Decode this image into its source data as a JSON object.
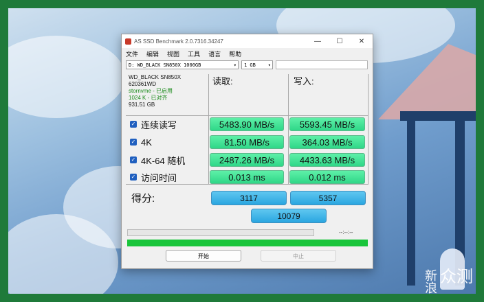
{
  "window": {
    "title": "AS SSD Benchmark 2.0.7316.34247",
    "controls": {
      "minimize": "—",
      "maximize": "☐",
      "close": "✕"
    }
  },
  "menu": [
    "文件",
    "编辑",
    "视图",
    "工具",
    "语言",
    "帮助"
  ],
  "toolbar": {
    "drive": "D: WD_BLACK SN850X 1000GB",
    "size": "1 GB"
  },
  "drive_info": {
    "model": "WD_BLACK SN850X",
    "firmware": "620361WD",
    "driver": "stornvme - 已启用",
    "alignment": "1024 K - 已对齐",
    "capacity": "931.51 GB"
  },
  "headers": {
    "read": "读取:",
    "write": "写入:"
  },
  "rows": [
    {
      "label": "连续读写",
      "read": "5483.90 MB/s",
      "write": "5593.45 MB/s"
    },
    {
      "label": "4K",
      "read": "81.50 MB/s",
      "write": "364.03 MB/s"
    },
    {
      "label": "4K-64 随机",
      "read": "2487.26 MB/s",
      "write": "4433.63 MB/s"
    },
    {
      "label": "访问时间",
      "read": "0.013 ms",
      "write": "0.012 ms"
    }
  ],
  "score": {
    "label": "得分:",
    "read": "3117",
    "write": "5357",
    "total": "10079"
  },
  "progress": {
    "time": "--:--:--",
    "overall_complete": 1.0
  },
  "buttons": {
    "start": "开始",
    "abort": "中止"
  },
  "watermark": {
    "line1": "新",
    "line2": "浪",
    "brand": "众测"
  },
  "colors": {
    "value_bg": "#2fd788",
    "score_bg": "#2aa6e0",
    "progress": "#19c53b",
    "border": "#1f7a3a"
  }
}
